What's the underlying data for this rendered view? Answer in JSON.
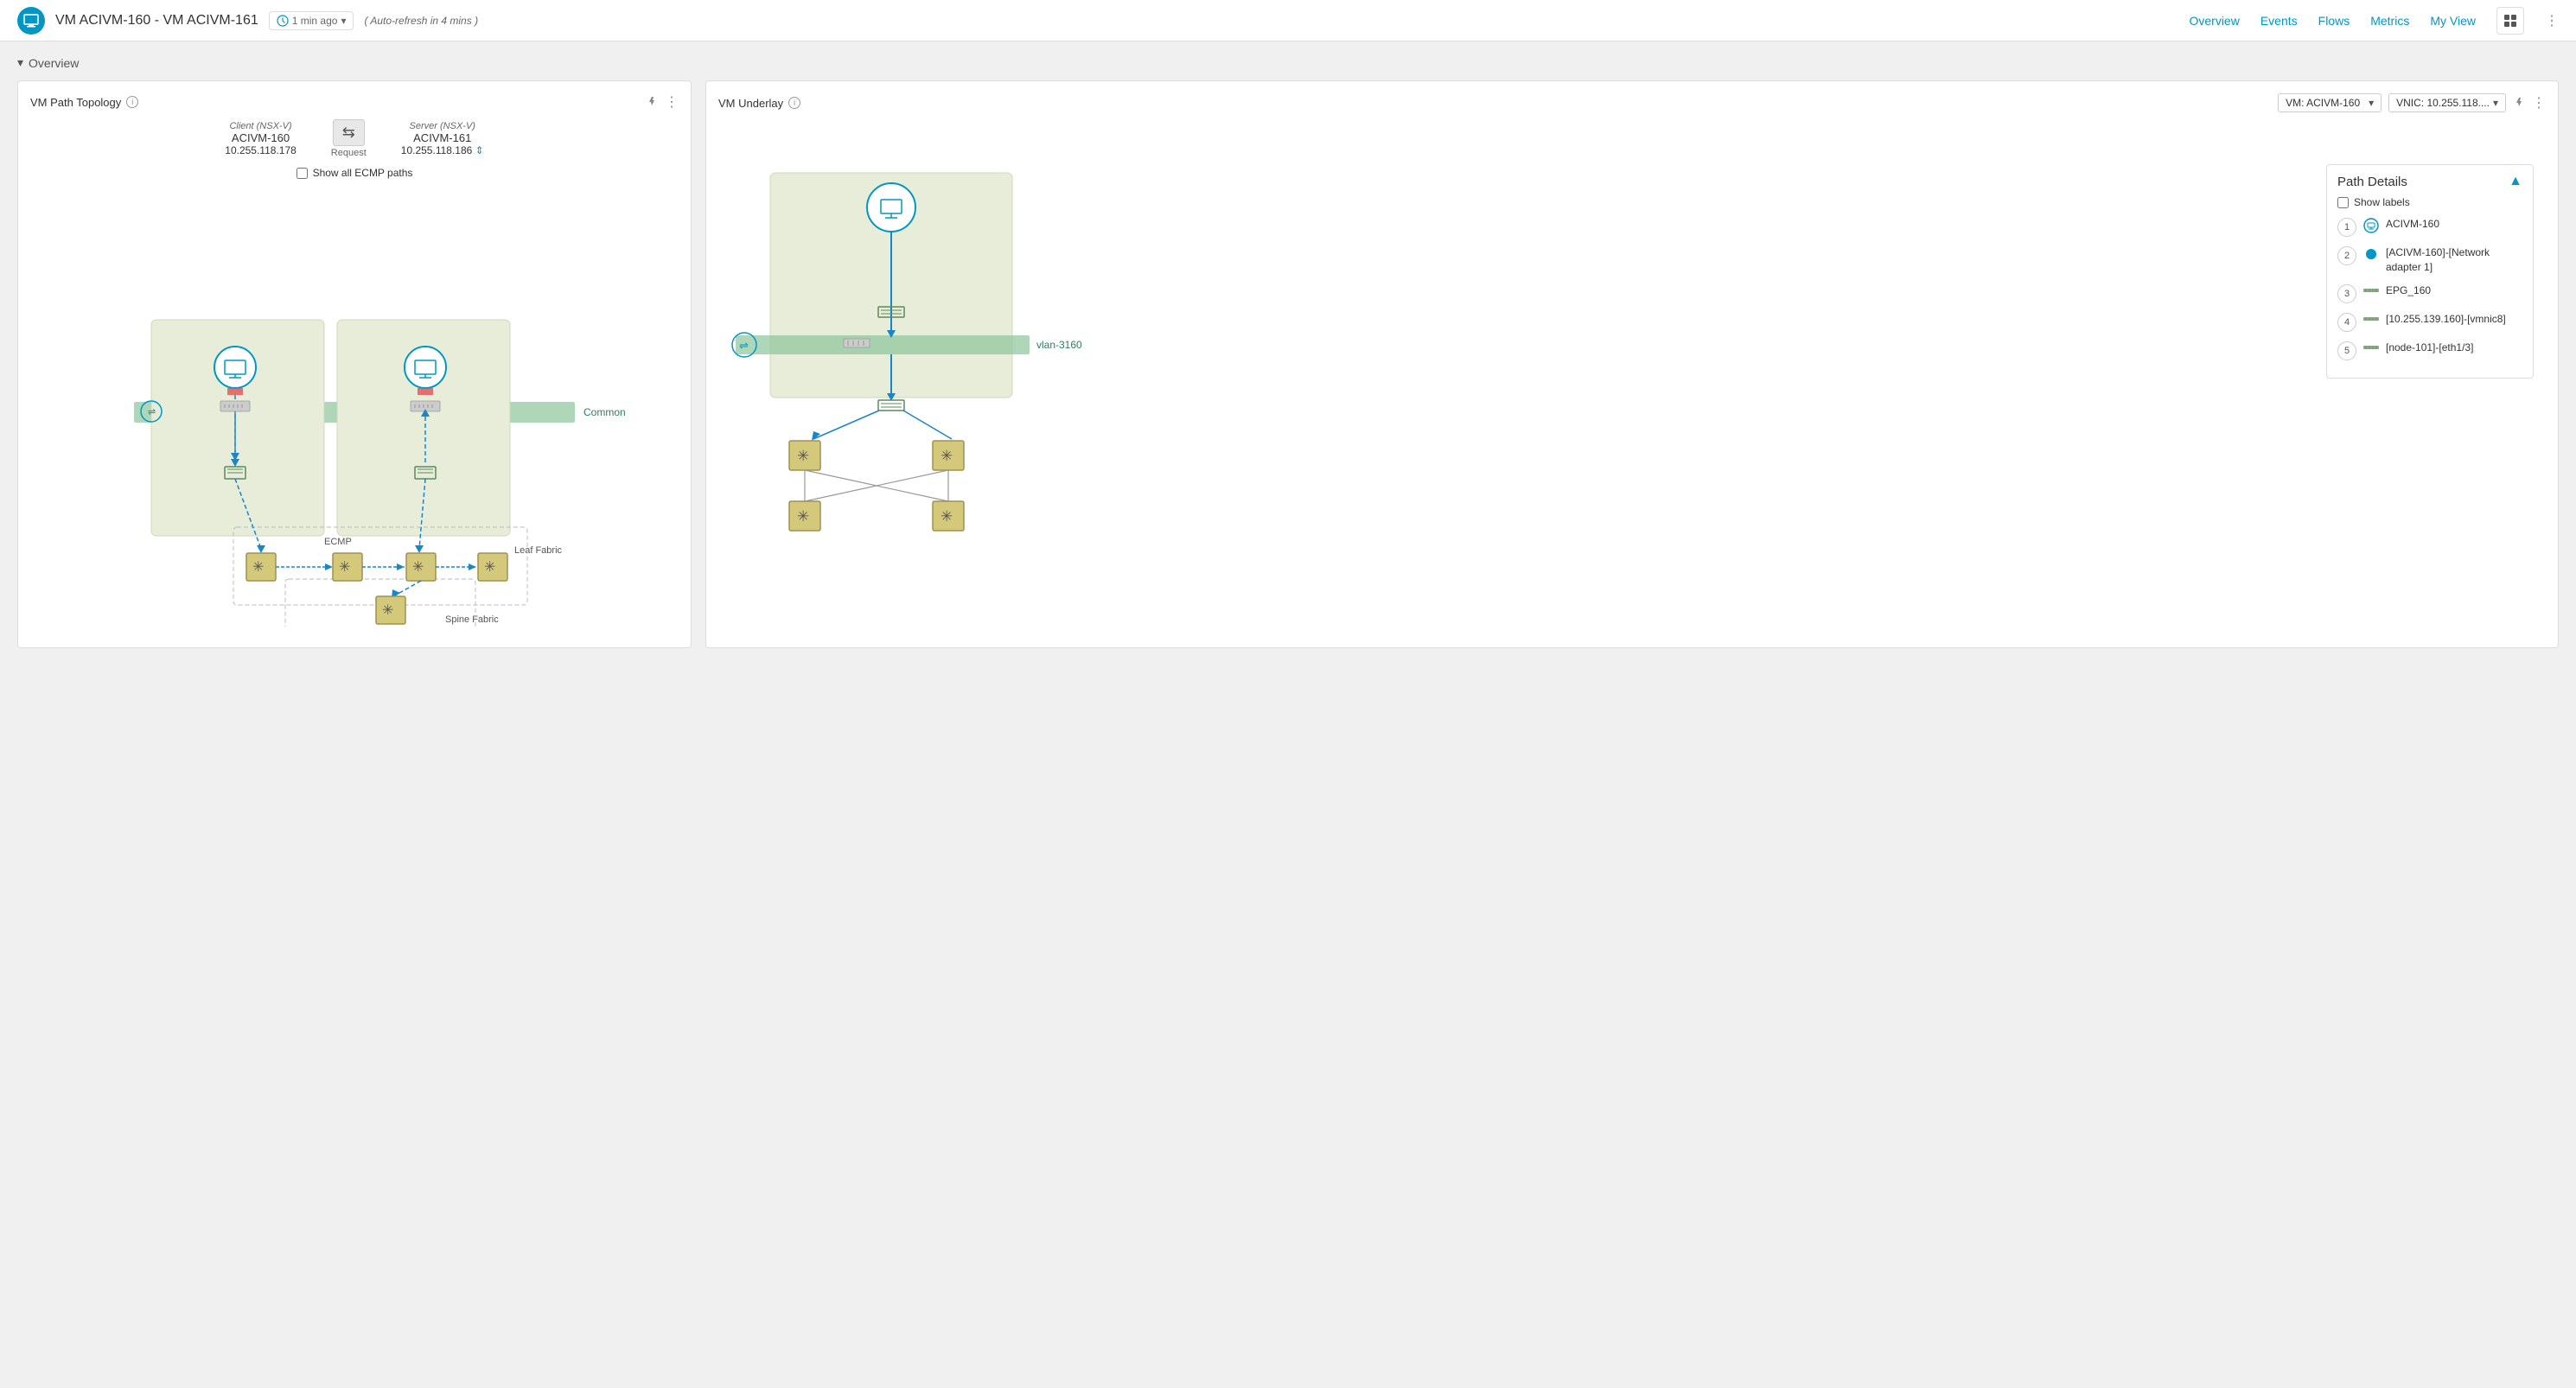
{
  "header": {
    "app_icon": "🖥",
    "page_title": "VM ACIVM-160 - VM ACIVM-161",
    "time_ago": "1 min ago",
    "time_dropdown": "▾",
    "auto_refresh": "( Auto-refresh  in 4 mins )",
    "nav_items": [
      {
        "label": "Overview",
        "id": "overview"
      },
      {
        "label": "Events",
        "id": "events"
      },
      {
        "label": "Flows",
        "id": "flows"
      },
      {
        "label": "Metrics",
        "id": "metrics"
      },
      {
        "label": "My View",
        "id": "my-view"
      }
    ]
  },
  "section": {
    "collapse_icon": "▾",
    "label": "Overview"
  },
  "left_panel": {
    "title": "VM Path Topology",
    "client_label": "Client (NSX-V)",
    "client_name": "ACIVM-160",
    "client_ip": "10.255.118.178",
    "arrow": "⇆",
    "request_label": "Request",
    "server_label": "Server (NSX-V)",
    "server_name": "ACIVM-161",
    "server_ip": "10.255.118.186",
    "ecmp_label": "Show all ECMP paths",
    "common_label": "Common",
    "ecmp_fabric_label": "ECMP",
    "leaf_fabric_label": "Leaf Fabric",
    "spine_fabric_label": "Spine Fabric"
  },
  "right_panel": {
    "title": "VM Underlay",
    "vm_dropdown_label": "VM: ACIVM-160",
    "vnic_dropdown_label": "VNIC: 10.255.118....",
    "vlan_label": "vlan-3160",
    "path_details": {
      "title": "Path Details",
      "show_labels": "Show labels",
      "steps": [
        {
          "num": 1,
          "icon_type": "vm",
          "label": "ACIVM-160"
        },
        {
          "num": 2,
          "icon_type": "dot",
          "label": "[ACIVM-160]-[Network adapter 1]"
        },
        {
          "num": 3,
          "icon_type": "link",
          "label": "EPG_160"
        },
        {
          "num": 4,
          "icon_type": "link",
          "label": "[10.255.139.160]-[vmnic8]"
        },
        {
          "num": 5,
          "icon_type": "link",
          "label": "[node-101]-[eth1/3]"
        }
      ]
    }
  }
}
